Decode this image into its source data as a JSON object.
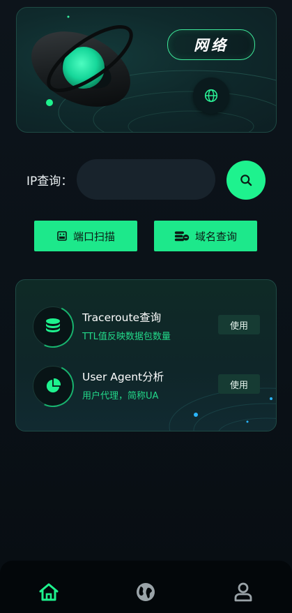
{
  "hero": {
    "badge_label": "网络",
    "globe_icon": "globe-icon"
  },
  "ip_search": {
    "label": "IP查询：",
    "value": "",
    "placeholder": "",
    "search_icon": "search-icon"
  },
  "actions": [
    {
      "label": "端口扫描",
      "icon": "router-icon"
    },
    {
      "label": "域名查询",
      "icon": "dns-icon"
    }
  ],
  "tools": [
    {
      "title": "Traceroute查询",
      "subtitle": "TTL值反映数据包数量",
      "button": "使用",
      "icon": "database-icon"
    },
    {
      "title": "User Agent分析",
      "subtitle": "用户代理，简称UA",
      "button": "使用",
      "icon": "pie-chart-icon"
    }
  ],
  "nav": [
    {
      "icon": "home-icon",
      "active": true
    },
    {
      "icon": "earth-icon",
      "active": false
    },
    {
      "icon": "user-icon",
      "active": false
    }
  ],
  "colors": {
    "accent": "#1ef28e",
    "background": "#0b1118",
    "card": "#0f2a26",
    "muted_icon": "#9aa3a8"
  }
}
